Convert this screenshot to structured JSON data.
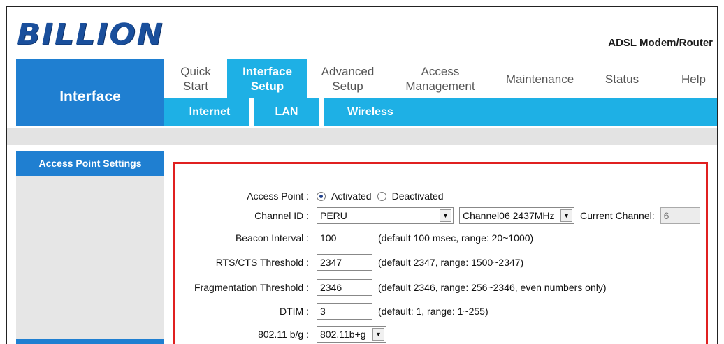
{
  "brand": {
    "logo": "BILLION",
    "product": "ADSL Modem/Router"
  },
  "section_title": "Interface",
  "nav": {
    "items": [
      {
        "label": "Quick\nStart",
        "active": false
      },
      {
        "label": "Interface\nSetup",
        "active": true
      },
      {
        "label": "Advanced\nSetup",
        "active": false
      },
      {
        "label": "Access\nManagement",
        "active": false
      },
      {
        "label": "Maintenance",
        "active": false
      },
      {
        "label": "Status",
        "active": false
      },
      {
        "label": "Help",
        "active": false
      }
    ],
    "subitems": [
      "Internet",
      "LAN",
      "Wireless"
    ]
  },
  "sidebar": {
    "items": [
      {
        "label": "Access Point Settings"
      }
    ]
  },
  "form": {
    "access_point": {
      "label": "Access Point :",
      "options": [
        "Activated",
        "Deactivated"
      ],
      "selected": "Activated"
    },
    "channel": {
      "label": "Channel ID :",
      "country": "PERU",
      "channel": "Channel06 2437MHz",
      "current_label": "Current Channel:",
      "current_value": "6"
    },
    "beacon": {
      "label": "Beacon Interval :",
      "value": "100",
      "hint": "(default 100 msec, range: 20~1000)"
    },
    "rts": {
      "label": "RTS/CTS Threshold :",
      "value": "2347",
      "hint": "(default 2347, range: 1500~2347)"
    },
    "frag": {
      "label": "Fragmentation Threshold :",
      "value": "2346",
      "hint": "(default 2346, range: 256~2346, even numbers only)"
    },
    "dtim": {
      "label": "DTIM :",
      "value": "3",
      "hint": "(default: 1, range: 1~255)"
    },
    "mode": {
      "label": "802.11 b/g :",
      "value": "802.11b+g"
    }
  },
  "colors": {
    "primary_blue": "#1f7fd1",
    "tab_cyan": "#1eb0e5",
    "highlight_red": "#e02020"
  },
  "icons": [
    "dropdown-arrow-icon",
    "radio-button-icon"
  ]
}
